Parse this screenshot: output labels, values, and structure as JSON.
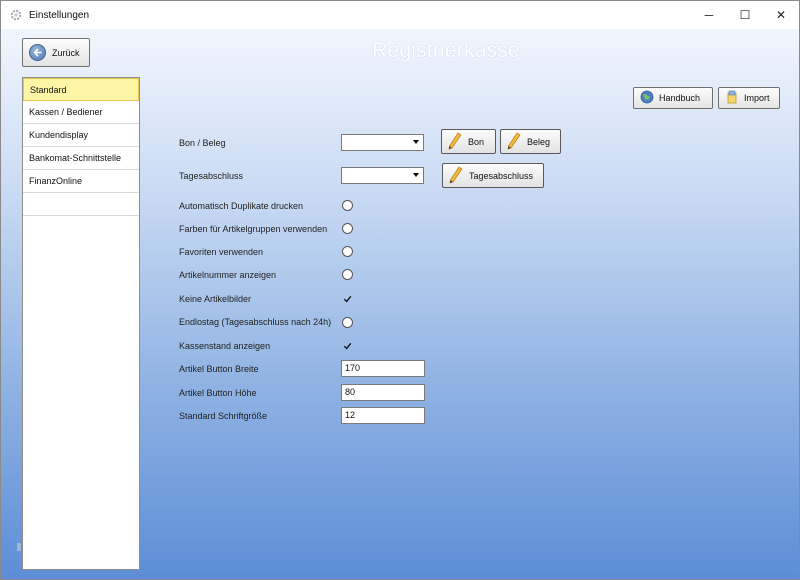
{
  "window": {
    "title": "Einstellungen",
    "controls": {
      "minimize": "─",
      "maximize": "☐",
      "close": "✕"
    }
  },
  "header": {
    "back_label": "Zurück",
    "page_title": "Registrierkasse"
  },
  "sidebar": {
    "items": [
      {
        "label": "Standard",
        "selected": true
      },
      {
        "label": "Kassen / Bediener",
        "selected": false
      },
      {
        "label": "Kundendisplay",
        "selected": false
      },
      {
        "label": "Bankomat-Schnittstelle",
        "selected": false
      },
      {
        "label": "FinanzOnline",
        "selected": false
      },
      {
        "label": "",
        "selected": false
      }
    ]
  },
  "toolbar": {
    "handbuch_label": "Handbuch",
    "import_label": "Import"
  },
  "form": {
    "bon_beleg_label": "Bon / Beleg",
    "bon_beleg_value": "",
    "bon_button_label": "Bon",
    "beleg_button_label": "Beleg",
    "tagesabschluss_label": "Tagesabschluss",
    "tagesabschluss_value": "",
    "tagesabschluss_button_label": "Tagesabschluss",
    "options": [
      {
        "label": "Automatisch Duplikate drucken",
        "checked": false
      },
      {
        "label": "Farben für Artikelgruppen verwenden",
        "checked": false
      },
      {
        "label": "Favoriten verwenden",
        "checked": false
      },
      {
        "label": "Artikelnummer anzeigen",
        "checked": false
      },
      {
        "label": "Keine Artikelbilder",
        "checked": true
      },
      {
        "label": "Endlostag (Tagesabschluss nach 24h)",
        "checked": false
      },
      {
        "label": "Kassenstand anzeigen",
        "checked": true
      }
    ],
    "artikel_button_breite_label": "Artikel Button Breite",
    "artikel_button_breite_value": "170",
    "artikel_button_hoehe_label": "Artikel Button Höhe",
    "artikel_button_hoehe_value": "80",
    "standard_schriftgroesse_label": "Standard Schriftgröße",
    "standard_schriftgroesse_value": "12"
  },
  "colors": {
    "selected_item_bg": "#fdf6a6",
    "gradient_top": "#f2f6fd",
    "gradient_bottom": "#5b8dd6",
    "title_color": "#ffffff"
  }
}
